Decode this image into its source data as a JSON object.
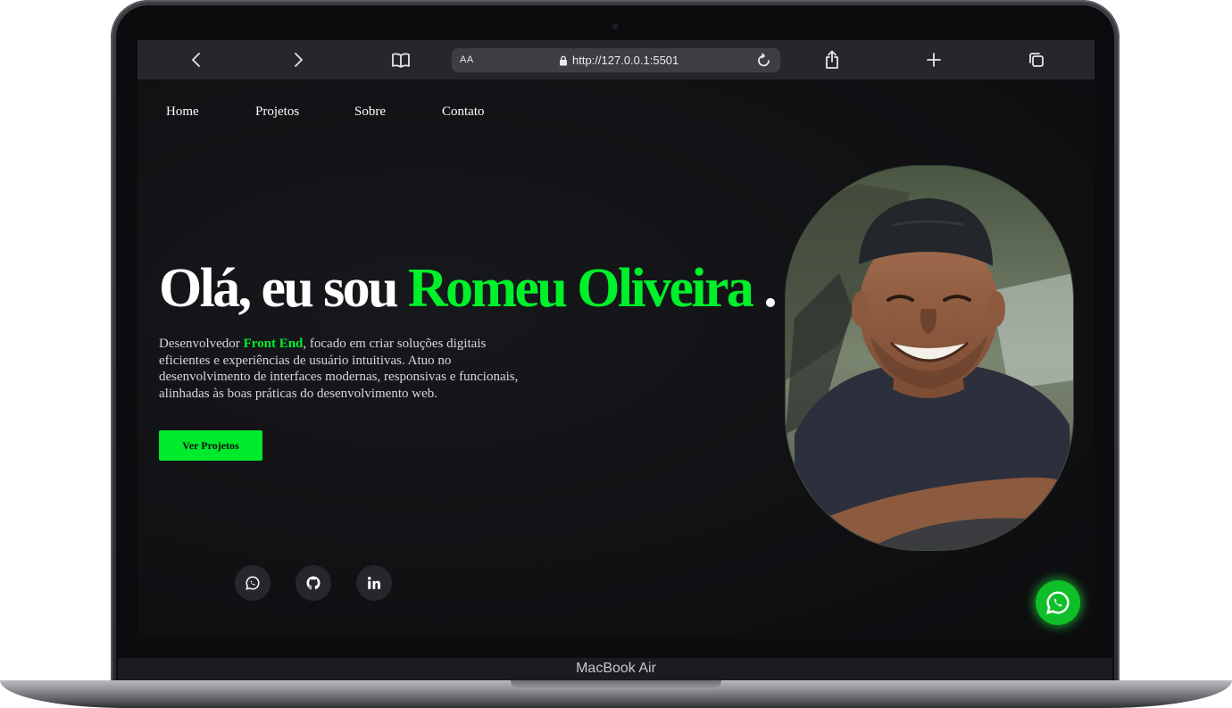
{
  "device": {
    "label": "MacBook Air"
  },
  "browser": {
    "text_size_label": "AA",
    "url": "http://127.0.0.1:5501"
  },
  "nav": {
    "items": [
      {
        "label": "Home"
      },
      {
        "label": "Projetos"
      },
      {
        "label": "Sobre"
      },
      {
        "label": "Contato"
      }
    ]
  },
  "hero": {
    "title_prefix": "Olá, eu sou ",
    "title_name": "Romeu Oliveira",
    "title_suffix": " .",
    "desc_prefix": "Desenvolvedor ",
    "desc_highlight": "Front End",
    "desc_rest": ", focado em criar soluções digitais eficientes e experiências de usuário intuitivas. Atuo no desenvolvimento de interfaces modernas, responsivas e funcionais, alinhadas às boas práticas do desenvolvimento web.",
    "cta_label": "Ver Projetos"
  },
  "social": {
    "items": [
      "whatsapp-icon",
      "github-icon",
      "linkedin-icon"
    ]
  },
  "colors": {
    "accent": "#00f02a",
    "background": "#111114",
    "whatsapp": "#0fbf2a"
  }
}
